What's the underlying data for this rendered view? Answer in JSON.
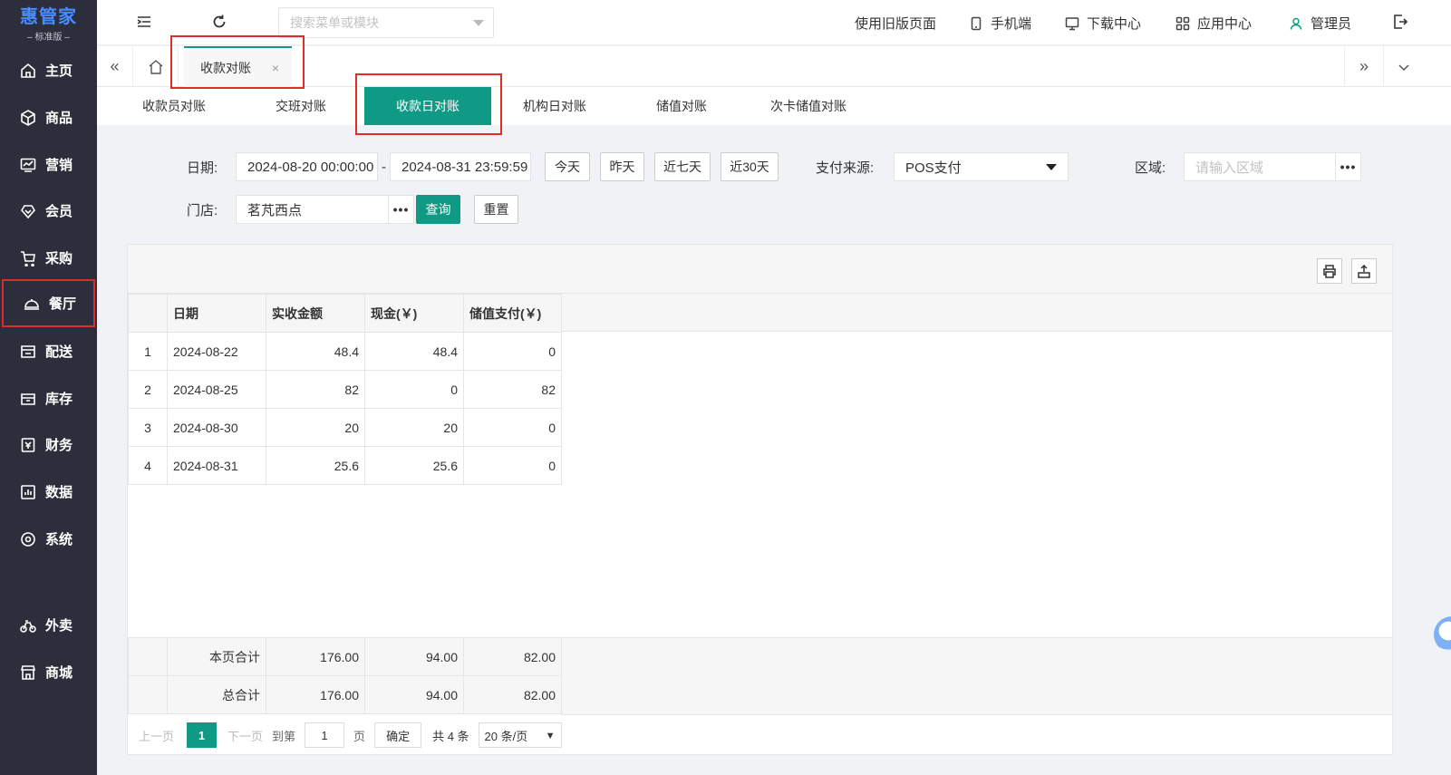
{
  "logo": {
    "main": "惠管家",
    "sub": "– 标准版 –"
  },
  "sidebar": {
    "items": [
      {
        "label": "主页",
        "icon": "home-icon"
      },
      {
        "label": "商品",
        "icon": "box-icon"
      },
      {
        "label": "营销",
        "icon": "trend-icon"
      },
      {
        "label": "会员",
        "icon": "vip-icon"
      },
      {
        "label": "采购",
        "icon": "cart-icon"
      },
      {
        "label": "餐厅",
        "icon": "cloche-icon",
        "active": true
      },
      {
        "label": "配送",
        "icon": "delivery-icon"
      },
      {
        "label": "库存",
        "icon": "inventory-icon"
      },
      {
        "label": "财务",
        "icon": "finance-icon"
      },
      {
        "label": "数据",
        "icon": "chart-icon"
      },
      {
        "label": "系统",
        "icon": "settings-icon"
      },
      {
        "label": "外卖",
        "icon": "bike-icon"
      },
      {
        "label": "商城",
        "icon": "store-icon"
      }
    ]
  },
  "topbar": {
    "search_placeholder": "搜索菜单或模块",
    "links": [
      "使用旧版页面",
      "手机端",
      "下载中心",
      "应用中心",
      "管理员"
    ]
  },
  "tabbar": {
    "page_tab": "收款对账",
    "close": "×",
    "left_arrows": "«",
    "right_arrows": "»",
    "dropdown": "⌄"
  },
  "subtabs": [
    "收款员对账",
    "交班对账",
    "收款日对账",
    "机构日对账",
    "储值对账",
    "次卡储值对账"
  ],
  "filters": {
    "date_label": "日期:",
    "date_start": "2024-08-20 00:00:00",
    "date_sep": "-",
    "date_end": "2024-08-31 23:59:59",
    "quick": [
      "今天",
      "昨天",
      "近七天",
      "近30天"
    ],
    "pay_source_label": "支付来源:",
    "pay_source_value": "POS支付",
    "region_label": "区域:",
    "region_placeholder": "请输入区域",
    "store_label": "门店:",
    "store_value": "茗芃西点",
    "dots": "•••",
    "query": "查询",
    "reset": "重置"
  },
  "table": {
    "headers": [
      "日期",
      "实收金额",
      "现金(￥)",
      "储值支付(￥)"
    ],
    "rows": [
      {
        "idx": "1",
        "date": "2024-08-22",
        "amount": "48.4",
        "cash": "48.4",
        "stored": "0"
      },
      {
        "idx": "2",
        "date": "2024-08-25",
        "amount": "82",
        "cash": "0",
        "stored": "82"
      },
      {
        "idx": "3",
        "date": "2024-08-30",
        "amount": "20",
        "cash": "20",
        "stored": "0"
      },
      {
        "idx": "4",
        "date": "2024-08-31",
        "amount": "25.6",
        "cash": "25.6",
        "stored": "0"
      }
    ],
    "page_total": {
      "label": "本页合计",
      "amount": "176.00",
      "cash": "94.00",
      "stored": "82.00"
    },
    "grand_total": {
      "label": "总合计",
      "amount": "176.00",
      "cash": "94.00",
      "stored": "82.00"
    }
  },
  "pager": {
    "prev": "上一页",
    "current": "1",
    "next": "下一页",
    "goto": "到第",
    "goto_value": "1",
    "page_unit": "页",
    "confirm": "确定",
    "total": "共 4 条",
    "page_size": "20 条/页"
  },
  "colors": {
    "accent": "#0f9a86",
    "sidebar": "#2c2f3b",
    "highlight": "#e02b2b"
  }
}
